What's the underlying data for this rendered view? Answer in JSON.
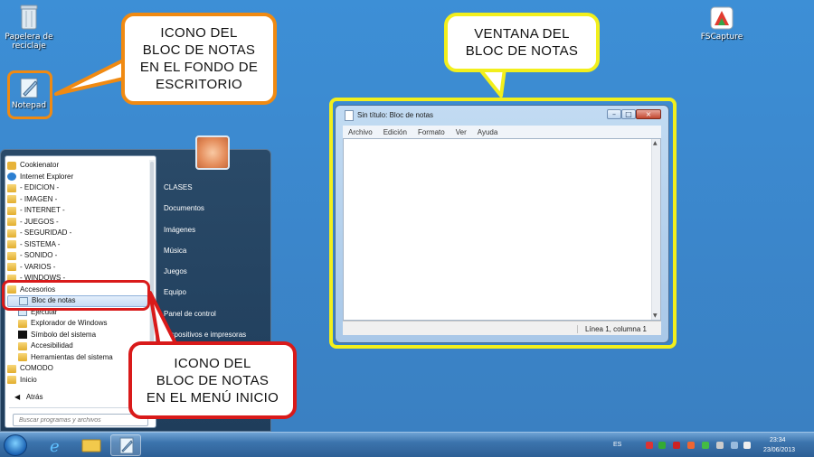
{
  "desktop": {
    "icons": {
      "recycle_bin": "Papelera de reciclaje",
      "notepad": "Notepad",
      "fscapture": "FSCapture"
    }
  },
  "callouts": {
    "desktop_icon": "ICONO DEL\nBLOC DE NOTAS\nEN EL FONDO DE\nESCRITORIO",
    "window": "VENTANA DEL\nBLOC DE NOTAS",
    "start_menu": "ICONO DEL\nBLOC DE NOTAS\nEN EL MENÚ INICIO"
  },
  "colors": {
    "callout_orange": "#f08a12",
    "callout_yellow": "#f2ef1c",
    "callout_red": "#d91a1a"
  },
  "notepad_window": {
    "title": "Sin título: Bloc de notas",
    "controls": [
      "minimize-icon",
      "maximize-icon",
      "close-icon"
    ],
    "menu": [
      "Archivo",
      "Edición",
      "Formato",
      "Ver",
      "Ayuda"
    ],
    "status": "Línea 1, columna 1"
  },
  "start_menu": {
    "programs": [
      {
        "label": "Cookienator",
        "icon": "app-icon"
      },
      {
        "label": "Internet Explorer",
        "icon": "ie-icon"
      },
      {
        "label": "- EDICION -",
        "icon": "folder-icon"
      },
      {
        "label": "- IMAGEN -",
        "icon": "folder-icon"
      },
      {
        "label": "- INTERNET -",
        "icon": "folder-icon"
      },
      {
        "label": "- JUEGOS -",
        "icon": "folder-icon"
      },
      {
        "label": "- SEGURIDAD -",
        "icon": "folder-icon"
      },
      {
        "label": "- SISTEMA -",
        "icon": "folder-icon"
      },
      {
        "label": "- SONIDO -",
        "icon": "folder-icon"
      },
      {
        "label": "- VARIOS -",
        "icon": "folder-icon"
      },
      {
        "label": "- WINDOWS -",
        "icon": "folder-icon"
      },
      {
        "label": "Accesorios",
        "icon": "folder-icon"
      },
      {
        "label": "Bloc de notas",
        "icon": "notepad-icon"
      },
      {
        "label": "Ejecutar",
        "icon": "run-icon"
      },
      {
        "label": "Explorador de Windows",
        "icon": "explorer-icon"
      },
      {
        "label": "Símbolo del sistema",
        "icon": "cmd-icon"
      },
      {
        "label": "Accesibilidad",
        "icon": "folder-icon"
      },
      {
        "label": "Herramientas del sistema",
        "icon": "folder-icon"
      },
      {
        "label": "COMODO",
        "icon": "folder-icon"
      },
      {
        "label": "Inicio",
        "icon": "folder-icon"
      }
    ],
    "back": "Atrás",
    "search_placeholder": "Buscar programas y archivos",
    "right": [
      "CLASES",
      "Documentos",
      "Imágenes",
      "Música",
      "Juegos",
      "Equipo",
      "Panel de control",
      "Dispositivos e impresoras"
    ]
  },
  "taskbar": {
    "language": "ES",
    "time": "23:34",
    "date": "23/06/2013"
  }
}
